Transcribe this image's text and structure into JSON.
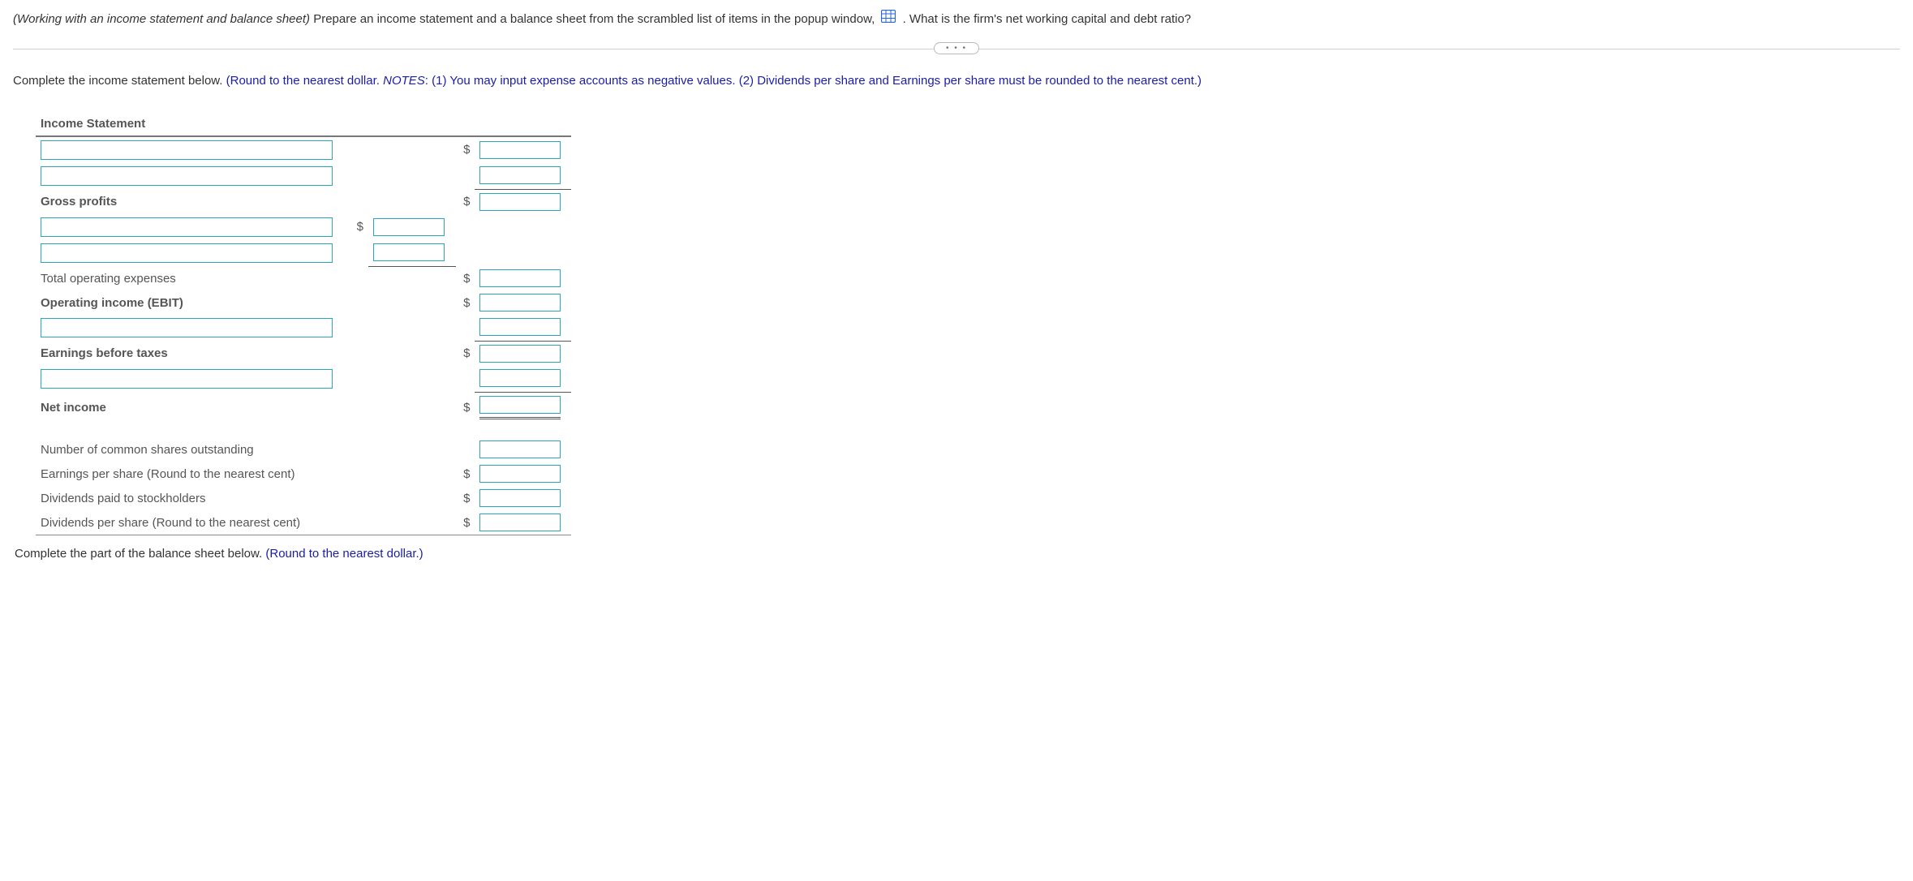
{
  "question": {
    "prefix_italic": "(Working with an income statement and balance sheet)",
    "part_a": " Prepare an income statement and a balance sheet from the scrambled list of items in the popup window, ",
    "part_b": ". What is the firm's net working capital and debt ratio?"
  },
  "divider_dots": "• • •",
  "instruction1": {
    "lead": "Complete the income statement below.  ",
    "note_open": "(Round to the nearest dollar. ",
    "notes_label": "NOTES",
    "note_body": ": (1) You may input expense accounts as negative values. (2) Dividends per share and Earnings per share must be rounded to the nearest cent.)"
  },
  "incst": {
    "header": "Income Statement",
    "gross_profits": "Gross profits",
    "total_op_exp": "Total operating expenses",
    "ebit": "Operating income (EBIT)",
    "ebt": "Earnings before taxes",
    "net_income": "Net income",
    "shares_out": "Number of common shares outstanding",
    "eps": "Earnings per share (Round to the nearest cent)",
    "div_paid": "Dividends paid to stockholders",
    "dps": "Dividends per share (Round to the nearest cent)",
    "dollar": "$"
  },
  "instruction2": {
    "lead": "Complete the part of the balance sheet below.  ",
    "note": "(Round to the nearest dollar.)"
  }
}
